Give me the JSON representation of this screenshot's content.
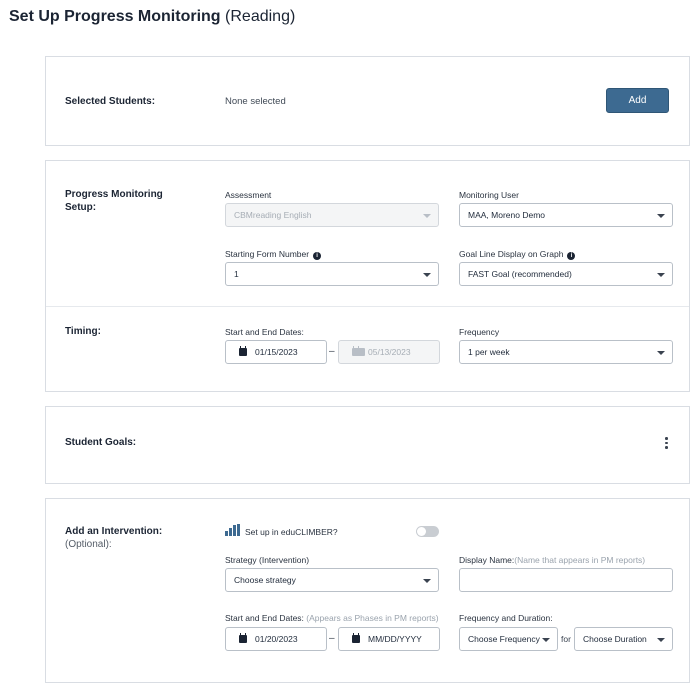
{
  "page": {
    "title_main": "Set Up Progress Monitoring",
    "title_sub": "(Reading)"
  },
  "selected_students": {
    "label": "Selected Students:",
    "value": "None selected",
    "add_button": "Add"
  },
  "setup": {
    "label": "Progress Monitoring Setup:",
    "assessment_label": "Assessment",
    "assessment_value": "CBMreading English",
    "monitoring_user_label": "Monitoring User",
    "monitoring_user_value": "MAA, Moreno Demo",
    "starting_form_label": "Starting Form Number",
    "starting_form_value": "1",
    "goal_line_label": "Goal Line Display on Graph",
    "goal_line_value": "FAST Goal (recommended)"
  },
  "timing": {
    "label": "Timing:",
    "dates_label": "Start and End Dates:",
    "start_date": "01/15/2023",
    "end_date": "05/13/2023",
    "dash": "–",
    "frequency_label": "Frequency",
    "frequency_value": "1 per week"
  },
  "student_goals": {
    "label": "Student Goals:"
  },
  "intervention": {
    "label": "Add an Intervention:",
    "optional": "(Optional):",
    "educlimber_label": "Set up in eduCLIMBER?",
    "educlimber_enabled": false,
    "strategy_label": "Strategy (Intervention)",
    "strategy_value": "Choose strategy",
    "display_name_label": "Display Name:",
    "display_name_hint": "(Name that appears in PM reports)",
    "display_name_value": "",
    "dates_label": "Start and End Dates:",
    "dates_hint": "(Appears as Phases in PM reports)",
    "start_date": "01/20/2023",
    "end_date_placeholder": "MM/DD/YYYY",
    "dash": "–",
    "freq_duration_label": "Frequency and Duration:",
    "frequency_value": "Choose Frequency",
    "for_label": "for",
    "duration_value": "Choose Duration"
  },
  "colors": {
    "primary_button": "#3d6a91",
    "border": "#d9dde3",
    "text": "#1b2433"
  }
}
